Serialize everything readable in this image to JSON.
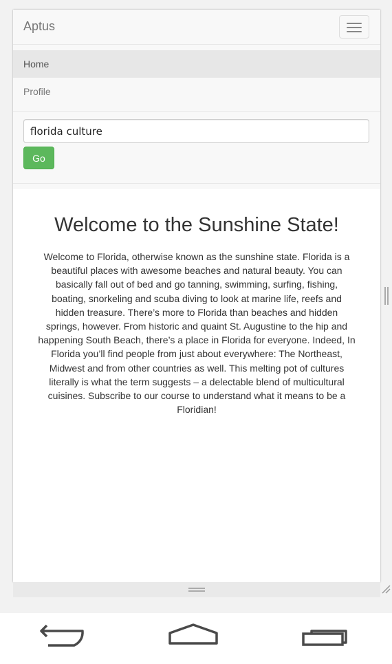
{
  "navbar": {
    "brand": "Aptus",
    "menu_items": [
      {
        "label": "Home"
      },
      {
        "label": "Profile"
      }
    ],
    "search": {
      "value": "florida culture",
      "button_label": "Go"
    },
    "toggle_icon": "hamburger-menu-icon"
  },
  "main": {
    "heading": "Welcome to the Sunshine State!",
    "body": "Welcome to Florida, otherwise known as the sunshine state. Florida is a beautiful places with awesome beaches and natural beauty. You can basically fall out of bed and go tanning, swimming, surfing, fishing, boating, snorkeling and scuba diving to look at marine life, reefs and hidden treasure. There’s more to Florida than beaches and hidden springs, however. From historic and quaint St. Augustine to the hip and happening South Beach, there’s a place in Florida for everyone. Indeed, In Florida you’ll find people from just about everywhere: The Northeast, Midwest and from other countries as well. This melting pot of cultures literally is what the term suggests – a delectable blend of multicultural cuisines. Subscribe to our course to understand what it means to be a Floridian!"
  },
  "system_nav": {
    "icons": [
      "back-icon",
      "home-icon",
      "recent-apps-icon"
    ]
  },
  "colors": {
    "go_button": "#5cb85c",
    "navbar_bg": "#f8f8f8",
    "active_item_bg": "#e7e7e7"
  }
}
